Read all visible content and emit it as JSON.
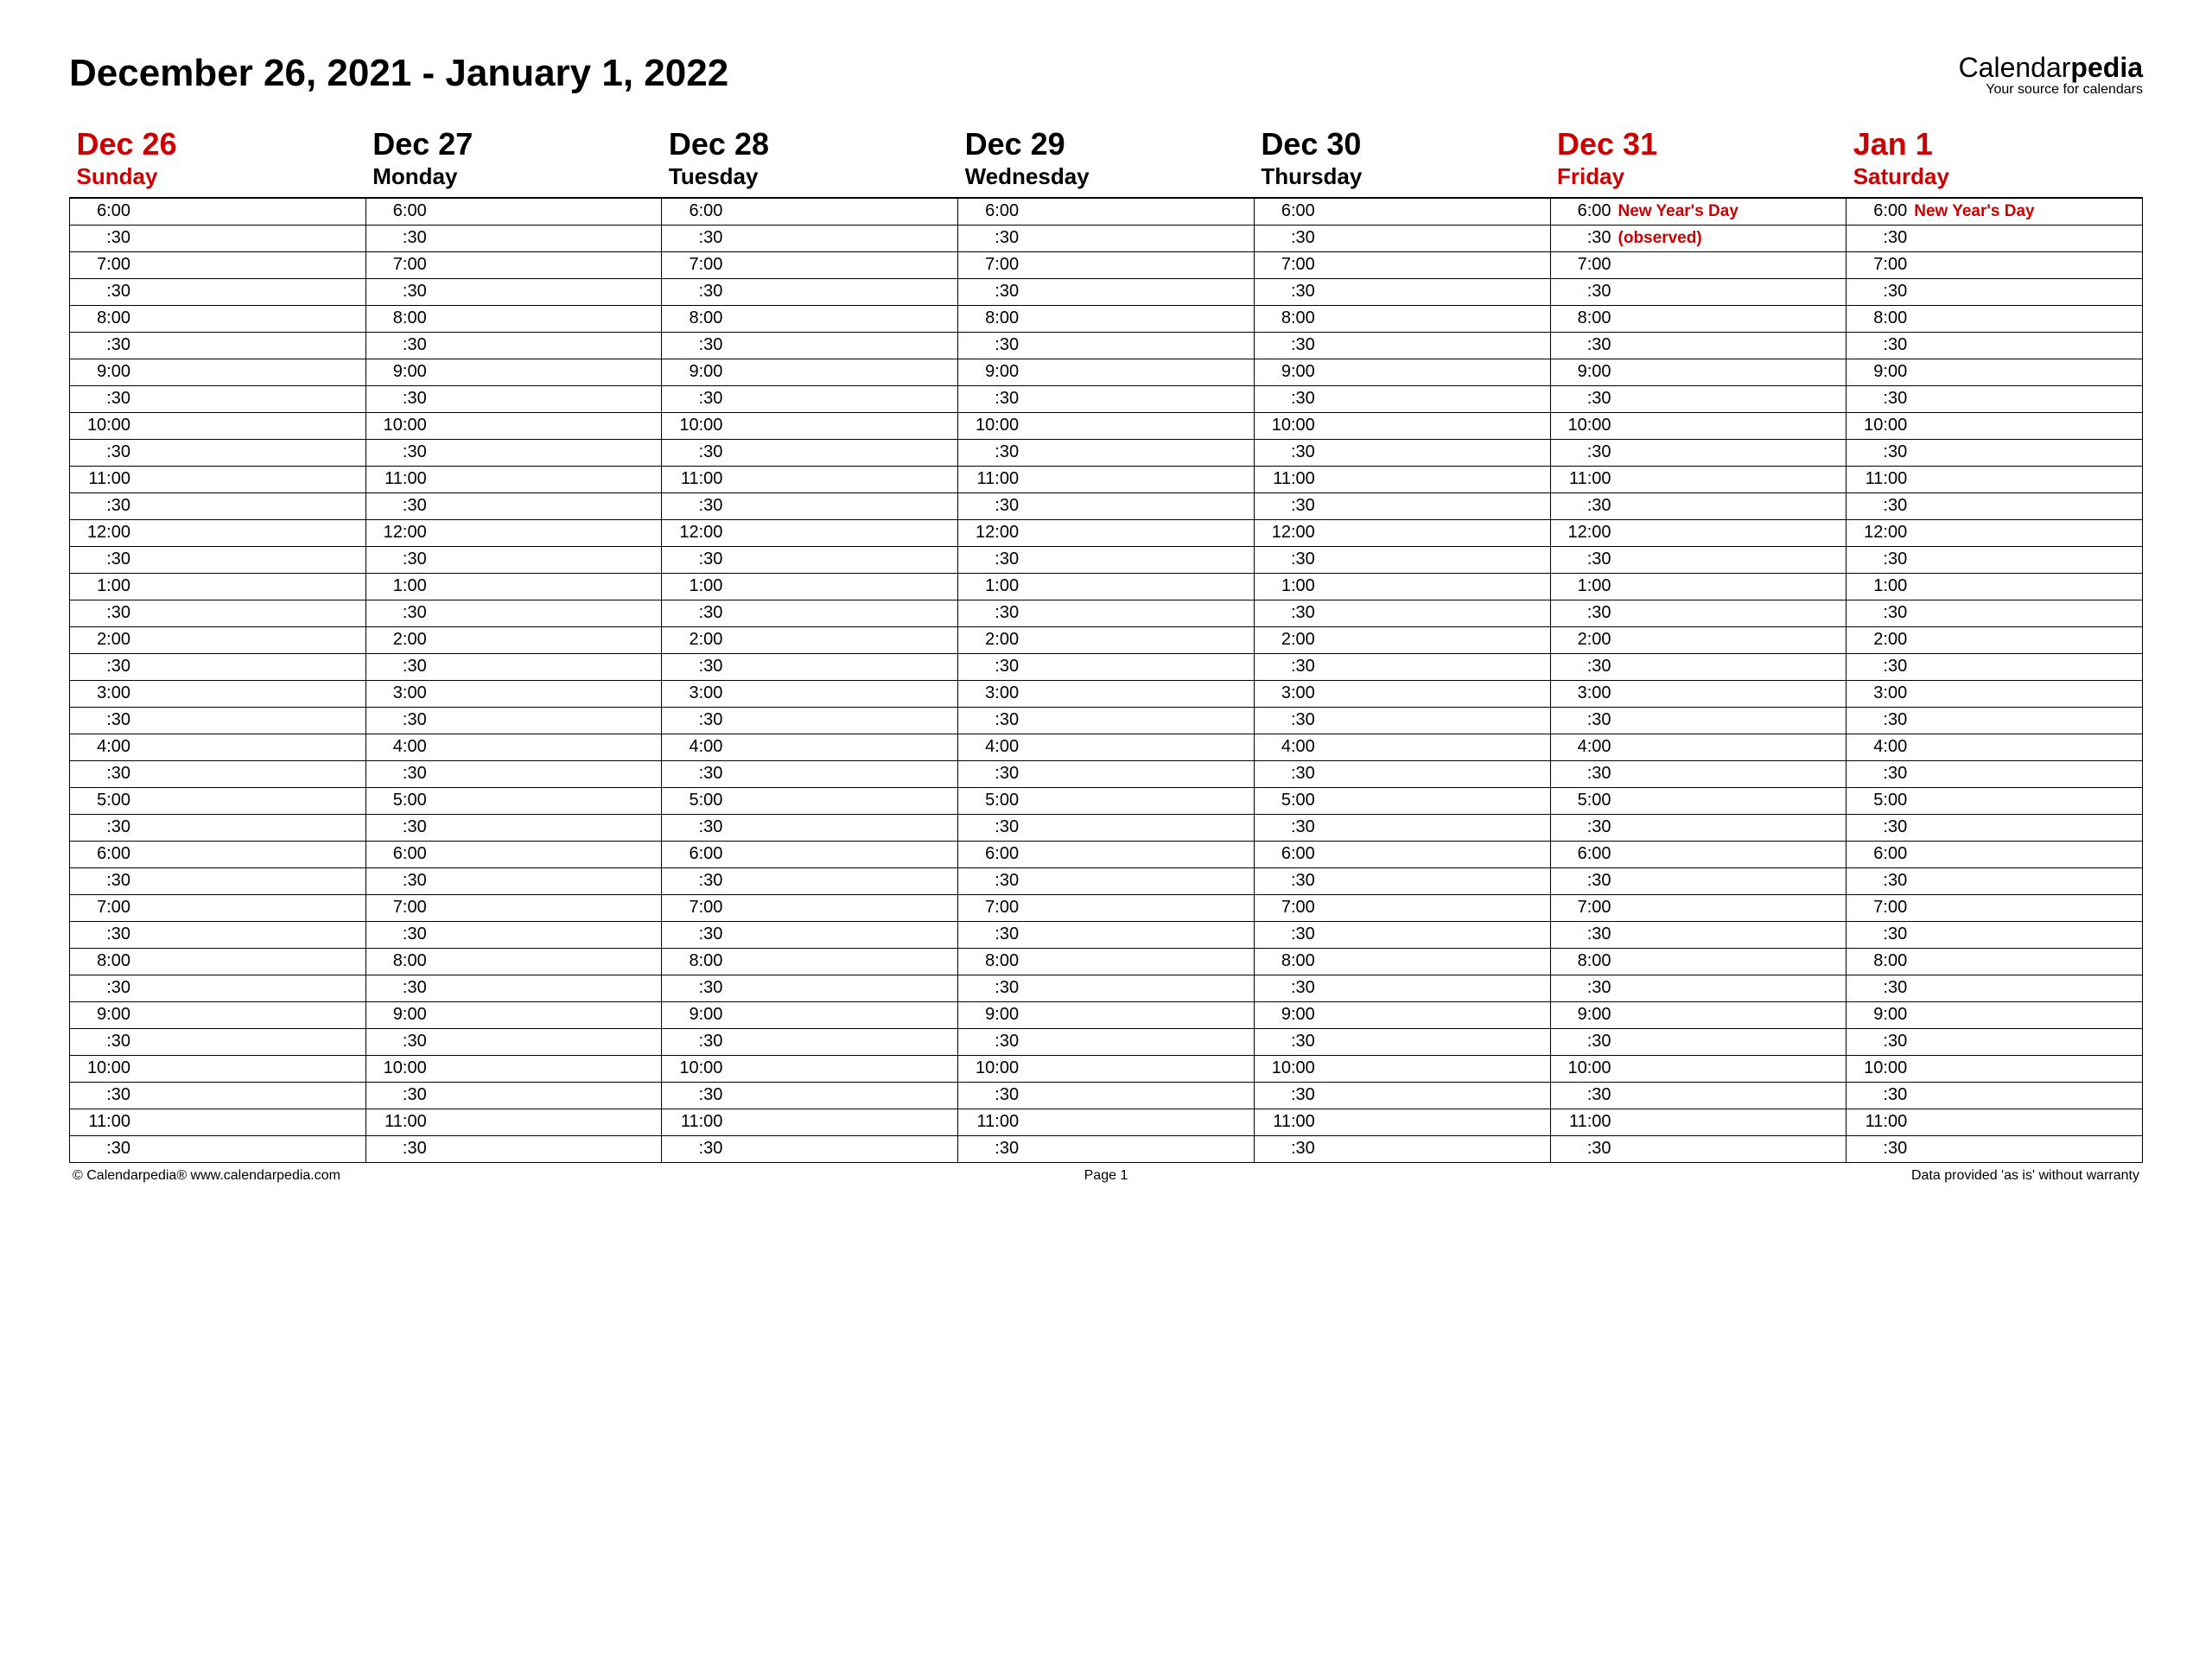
{
  "header": {
    "title": "December 26, 2021 - January 1, 2022",
    "brand_left": "Calendar",
    "brand_right": "pedia",
    "brand_tag": "Your source for calendars"
  },
  "days": [
    {
      "date": "Dec 26",
      "dow": "Sunday",
      "highlight": true,
      "notes": {}
    },
    {
      "date": "Dec 27",
      "dow": "Monday",
      "highlight": false,
      "notes": {}
    },
    {
      "date": "Dec 28",
      "dow": "Tuesday",
      "highlight": false,
      "notes": {}
    },
    {
      "date": "Dec 29",
      "dow": "Wednesday",
      "highlight": false,
      "notes": {}
    },
    {
      "date": "Dec 30",
      "dow": "Thursday",
      "highlight": false,
      "notes": {}
    },
    {
      "date": "Dec 31",
      "dow": "Friday",
      "highlight": true,
      "notes": {
        "0": "New Year's Day",
        "1": "(observed)"
      }
    },
    {
      "date": "Jan 1",
      "dow": "Saturday",
      "highlight": true,
      "notes": {
        "0": "New Year's Day"
      }
    }
  ],
  "times": [
    "6:00",
    ":30",
    "7:00",
    ":30",
    "8:00",
    ":30",
    "9:00",
    ":30",
    "10:00",
    ":30",
    "11:00",
    ":30",
    "12:00",
    ":30",
    "1:00",
    ":30",
    "2:00",
    ":30",
    "3:00",
    ":30",
    "4:00",
    ":30",
    "5:00",
    ":30",
    "6:00",
    ":30",
    "7:00",
    ":30",
    "8:00",
    ":30",
    "9:00",
    ":30",
    "10:00",
    ":30",
    "11:00",
    ":30"
  ],
  "footer": {
    "left": "© Calendarpedia®   www.calendarpedia.com",
    "center": "Page 1",
    "right": "Data provided 'as is' without warranty"
  }
}
